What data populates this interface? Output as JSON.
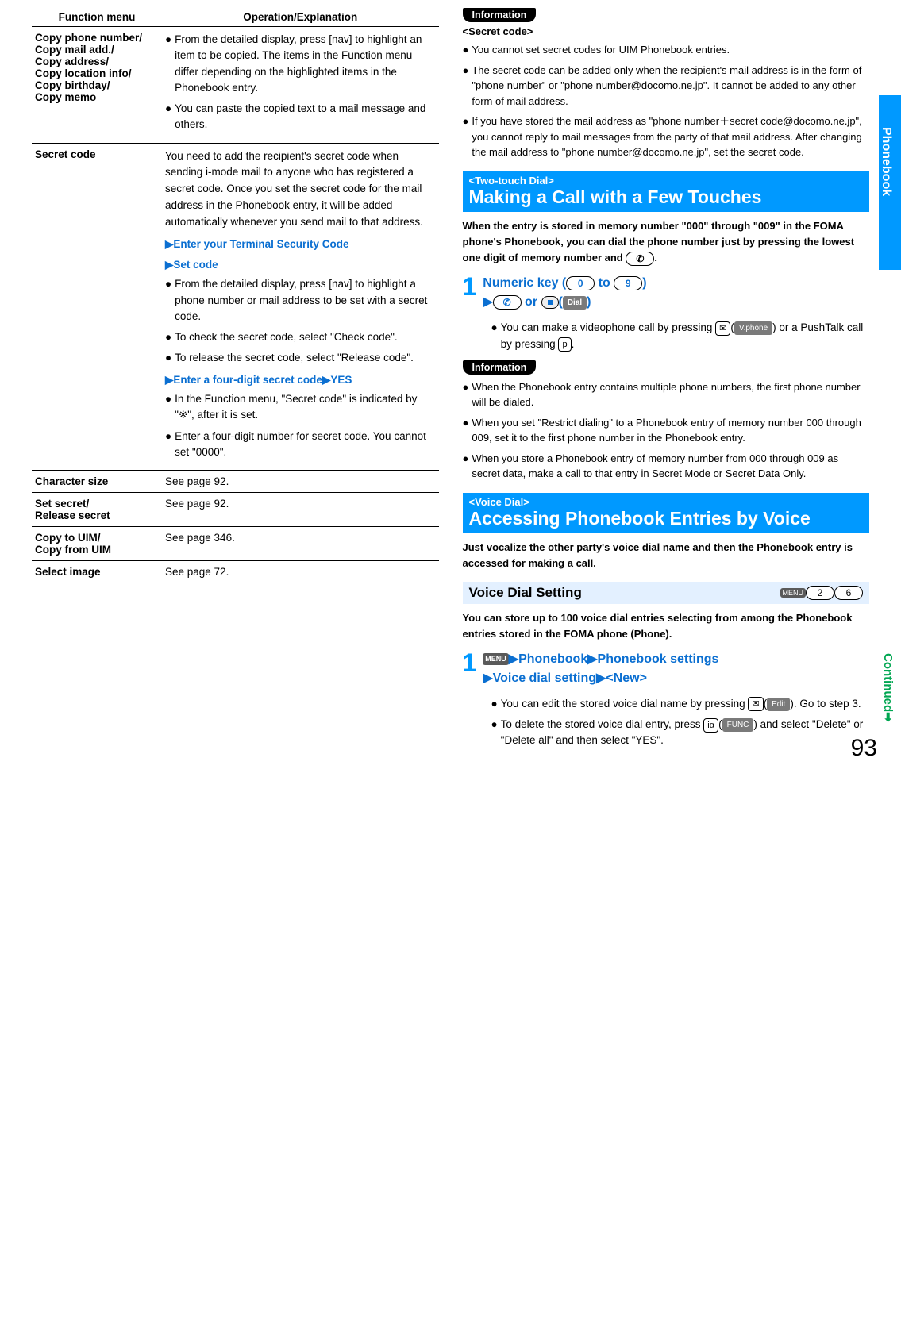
{
  "side_tab": "Phonebook",
  "continued": "Continued",
  "page_number": "93",
  "left_table": {
    "header_left": "Function menu",
    "header_right": "Operation/Explanation",
    "rows": [
      {
        "label": "Copy phone number/\nCopy mail add./\nCopy address/\nCopy location info/\nCopy birthday/\nCopy memo",
        "items": [
          "From the detailed display, press [nav] to highlight an item to be copied. The items in the Function menu differ depending on the highlighted items in the Phonebook entry.",
          "You can paste the copied text to a mail message and others."
        ]
      },
      {
        "label": "Secret code",
        "intro": "You need to add the recipient's secret code when sending i-mode mail to anyone who has registered a secret code. Once you set the secret code for the mail address in the Phonebook entry, it will be added automatically whenever you send mail to that address.",
        "step1": "Enter your Terminal Security Code",
        "step2": "Set code",
        "items1": [
          "From the detailed display, press [nav] to highlight a phone number or mail address to be set with a secret code.",
          "To check the secret code, select \"Check code\".",
          "To release the secret code, select \"Release code\"."
        ],
        "step3": "Enter a four-digit secret code",
        "step3_yes": "YES",
        "items2": [
          "In the Function menu, \"Secret code\" is indicated by \"※\", after it is set.",
          "Enter a four-digit number for secret code. You cannot set \"0000\"."
        ]
      },
      {
        "label": "Character size",
        "text": "See page 92."
      },
      {
        "label": "Set secret/\nRelease secret",
        "text": "See page 92."
      },
      {
        "label": "Copy to UIM/\nCopy from UIM",
        "text": "See page 346."
      },
      {
        "label": "Select image",
        "text": "See page 72."
      }
    ]
  },
  "info1": {
    "badge": "Information",
    "sub": "<Secret code>",
    "items": [
      "You cannot set secret codes for UIM Phonebook entries.",
      "The secret code can be added only when the recipient's mail address is in the form of \"phone number\" or \"phone number@docomo.ne.jp\". It cannot be added to any other form of mail address.",
      "If you have stored the mail address as \"phone number＋secret code@docomo.ne.jp\", you cannot reply to mail messages from the party of that mail address. After changing the mail address to \"phone number@docomo.ne.jp\", set the secret code."
    ]
  },
  "section1": {
    "tag": "<Two-touch Dial>",
    "title": "Making a Call with a Few Touches",
    "desc": "When the entry is stored in memory number \"000\" through \"009\" in the FOMA phone's Phonebook, you can dial the phone number just by pressing the lowest one digit of memory number and ",
    "step_title_a": "Numeric key (",
    "step_title_b": " to ",
    "step_title_c": ")",
    "step_or": " or ",
    "dial_chip": "Dial",
    "sub_items": [
      {
        "text_a": "You can make a videophone call by pressing ",
        "chip": "V.phone",
        "text_b": " or a PushTalk call by pressing "
      }
    ]
  },
  "info2": {
    "badge": "Information",
    "items": [
      "When the Phonebook entry contains multiple phone numbers, the first phone number will be dialed.",
      "When you set \"Restrict dialing\" to a Phonebook entry of memory number 000 through 009, set it to the first phone number in the Phonebook entry.",
      "When you store a Phonebook entry of memory number from 000 through 009 as secret data, make a call to that entry in Secret Mode or Secret Data Only."
    ]
  },
  "section2": {
    "tag": "<Voice Dial>",
    "title": "Accessing Phonebook Entries by Voice",
    "desc": "Just vocalize the other party's voice dial name and then the Phonebook entry is accessed for making a call.",
    "sub_title": "Voice Dial Setting",
    "menu_digits": [
      "2",
      "6"
    ],
    "sub_desc": "You can store up to 100 voice dial entries selecting from among the Phonebook entries stored in the FOMA phone (Phone).",
    "step_parts": {
      "phonebook": "Phonebook",
      "phonebook_settings": "Phonebook settings",
      "voice_dial": "Voice dial setting",
      "new": "<New>"
    },
    "sub_items": [
      {
        "text_a": "You can edit the stored voice dial name by pressing ",
        "chip": "Edit",
        "text_b": ". Go to step 3."
      },
      {
        "text_a": "To delete the stored voice dial entry, press ",
        "chip": "FUNC",
        "text_b": " and select \"Delete\" or \"Delete all\" and then select \"YES\"."
      }
    ]
  }
}
